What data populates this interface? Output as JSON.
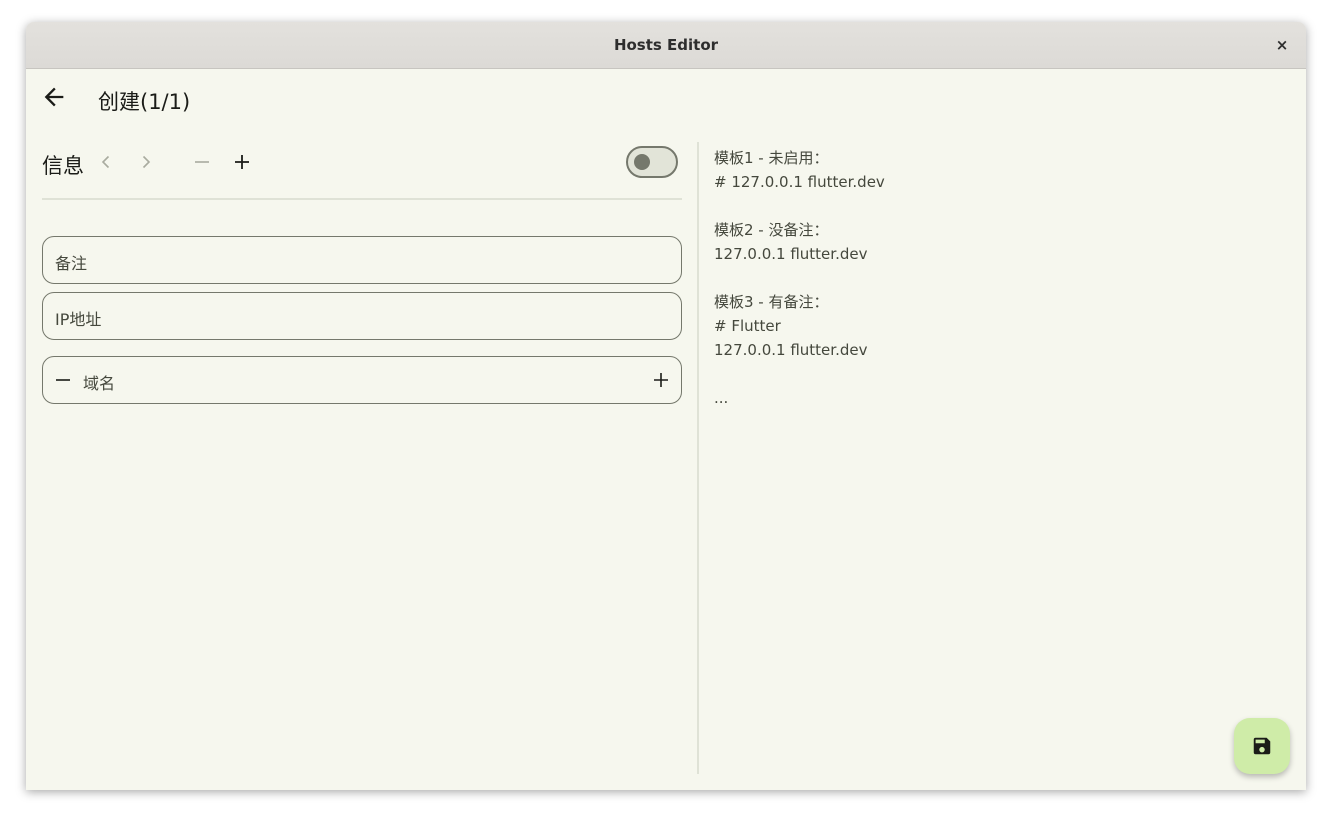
{
  "window": {
    "title": "Hosts Editor",
    "close_label": "×"
  },
  "appbar": {
    "title": "创建(1/1)"
  },
  "editor": {
    "section_title": "信息",
    "toggle_enabled": false,
    "fields": {
      "note_placeholder": "备注",
      "ip_placeholder": "IP地址",
      "domain_placeholder": "域名"
    }
  },
  "help": {
    "lines": [
      "模板1 - 未启用：",
      "# 127.0.0.1 flutter.dev",
      "",
      "模板2 - 没备注：",
      "127.0.0.1 flutter.dev",
      "",
      "模板3 - 有备注：",
      "# Flutter",
      "127.0.0.1 flutter.dev",
      "",
      "..."
    ]
  },
  "colors": {
    "background": "#f6f7ee",
    "fab": "#cfeca8",
    "outline": "#75786c",
    "text": "#1b1c18"
  },
  "icons": {
    "back": "arrow-left",
    "prev": "chevron-left",
    "next": "chevron-right",
    "remove": "minus",
    "add": "plus",
    "save": "floppy-disk"
  }
}
